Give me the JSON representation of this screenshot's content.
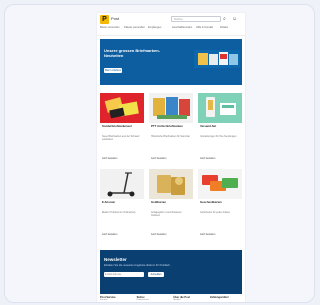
{
  "header": {
    "logo_letter": "P",
    "brand": "Post",
    "search_placeholder": "Suche",
    "nav": [
      "Briefe versenden",
      "Pakete versenden",
      "Empfangen",
      "Geschäftskunden",
      "Hilfe & Kontakt",
      "Filialen"
    ]
  },
  "hero": {
    "title": "Unsere grossen Briefmarken-Neuheiten",
    "button": "Mehr erfahren"
  },
  "products": [
    {
      "title": "Sonderbriefmarkenset",
      "desc": "Neue Briefmarken aus der Schweiz entdecken",
      "cta": "Jetzt bestellen",
      "img": "stamps-red"
    },
    {
      "title": "PTT Archiv Briefmarken",
      "desc": "Historische Briefmarken für Sammler",
      "cta": "Jetzt bestellen",
      "img": "stamps-mixed"
    },
    {
      "title": "Versand-Set",
      "desc": "Verpackungen für Ihre Sendungen",
      "cta": "Jetzt bestellen",
      "img": "phone-green"
    },
    {
      "title": "E-Scooter",
      "desc": "Elektro Trottinett im Onlineshop",
      "cta": "Jetzt bestellen",
      "img": "scooter"
    },
    {
      "title": "Goldbarren",
      "desc": "Anlagegold in verschiedenen Grössen",
      "cta": "Jetzt bestellen",
      "img": "gold"
    },
    {
      "title": "Geschenkkarten",
      "desc": "Gutscheine für jeden Anlass",
      "cta": "Jetzt bestellen",
      "img": "cards"
    }
  ],
  "newsletter": {
    "title": "Newsletter",
    "text": "Erhalten Sie die neuesten Angebote direkt in Ihr Postfach.",
    "input_placeholder": "E-Mail-Adresse",
    "button": "Anmelden"
  },
  "footer": [
    {
      "heading": "Post Service",
      "links": [
        "Kontakt",
        "Filialen"
      ]
    },
    {
      "heading": "Sicher",
      "links": [
        "Datenschutz",
        "AGB"
      ]
    },
    {
      "heading": "Über die Post",
      "links": [
        "Medien",
        "Jobs"
      ]
    },
    {
      "heading": "Zahlungsmittel",
      "links": [
        "",
        ""
      ]
    }
  ],
  "colors": {
    "brand_yellow": "#f5b800",
    "hero_blue": "#0c5ea0",
    "news_blue": "#0a3f72"
  }
}
